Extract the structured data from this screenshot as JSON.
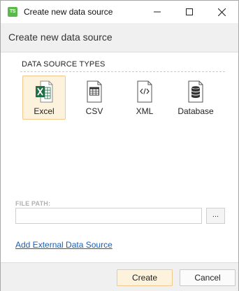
{
  "window": {
    "app_icon_text": "TS",
    "title": "Create new data source"
  },
  "header": {
    "title": "Create new data source"
  },
  "section": {
    "title": "DATA SOURCE TYPES"
  },
  "data_source_types": [
    {
      "label": "Excel",
      "icon": "excel-file-icon",
      "selected": true
    },
    {
      "label": "CSV",
      "icon": "csv-file-icon",
      "selected": false
    },
    {
      "label": "XML",
      "icon": "xml-file-icon",
      "selected": false
    },
    {
      "label": "Database",
      "icon": "database-file-icon",
      "selected": false
    }
  ],
  "file_path": {
    "label": "FILE PATH:",
    "value": "",
    "browse_label": "..."
  },
  "links": {
    "add_external": "Add External Data Source"
  },
  "buttons": {
    "create": "Create",
    "cancel": "Cancel"
  },
  "colors": {
    "selection_fill": "#fdf3dd",
    "selection_border": "#f2c98c",
    "link": "#1a5fb4",
    "excel_green": "#1e7145",
    "app_icon": "#5bb84a"
  }
}
